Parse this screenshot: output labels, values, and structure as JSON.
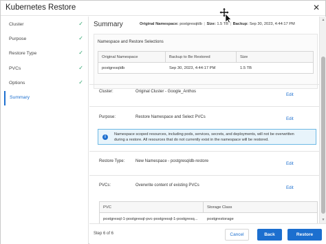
{
  "dialog": {
    "title": "Kubernetes Restore"
  },
  "sidebar": {
    "steps": [
      {
        "label": "Cluster",
        "done": true
      },
      {
        "label": "Purpose",
        "done": true
      },
      {
        "label": "Restore Type",
        "done": true
      },
      {
        "label": "PVCs",
        "done": true
      },
      {
        "label": "Options",
        "done": true
      },
      {
        "label": "Summary",
        "done": false,
        "active": true
      }
    ],
    "check_glyph": "✓"
  },
  "summary": {
    "title": "Summary",
    "original_namespace_label": "Original Namespace:",
    "original_namespace_value": "postgresqldb",
    "size_label": "Size:",
    "size_value": "1.5 TB",
    "backup_label": "Backup:",
    "backup_value": "Sep 30, 2023, 4:44:17 PM"
  },
  "namespace_section": {
    "heading": "Namespace and Restore Selections",
    "columns": [
      "Original Namespace",
      "Backup to Be Restored",
      "Size"
    ],
    "rows": [
      [
        "postgresqldb",
        "Sep 30, 2023, 4:44:17 PM",
        "1.5 TB"
      ]
    ]
  },
  "cluster": {
    "label": "Cluster:",
    "value": "Original Cluster - Google_Anthos",
    "edit": "Edit"
  },
  "purpose": {
    "label": "Purpose:",
    "value": "Restore Namespace and Select PVCs",
    "edit": "Edit",
    "info_line1": "Namespace scoped resources, including pods, services, secrets, and deployments, will not be overwritten",
    "info_line2": "during a restore. All resources that do not currently exist in the namespace will be restored."
  },
  "restore_type": {
    "label": "Restore Type:",
    "value": "New Namespace - postgresqldb-restore",
    "edit": "Edit"
  },
  "pvcs": {
    "label": "PVCs:",
    "value": "Overwrite content of existing PVCs",
    "edit": "Edit",
    "columns": [
      "PVC",
      "Storage Class"
    ],
    "rows": [
      [
        "postgresql-1-postgresql-pvc-postgresql-1-postgresq...",
        "postgrestorage"
      ]
    ]
  },
  "footer": {
    "step_text": "Step 6 of 6",
    "cancel": "Cancel",
    "back": "Back",
    "restore": "Restore"
  },
  "icons": {
    "close": "close-icon",
    "info": "info-icon",
    "check": "check-icon",
    "cursor": "move-cursor-icon"
  },
  "colors": {
    "accent": "#1c6fcf",
    "check": "#2aa36b",
    "info_bg": "#e8f4fb",
    "info_border": "#6cb8e4"
  }
}
